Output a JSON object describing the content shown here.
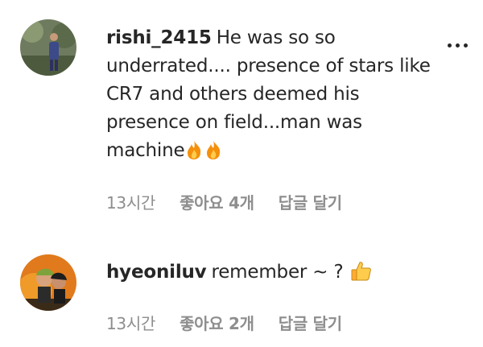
{
  "comments": [
    {
      "username": "rishi_2415",
      "text": "He was so so underrated.... presence of stars like CR7 and others deemed his presence on field...man was machine",
      "emoji": "fire-emoji x2",
      "time": "13시간",
      "likes": "좋아요 4개",
      "reply": "답글 달기"
    },
    {
      "username": "hyeoniluv",
      "text": "remember ~ ?",
      "emoji": "thumbs-up-emoji",
      "time": "13시간",
      "likes": "좋아요 2개",
      "reply": "답글 달기"
    }
  ]
}
